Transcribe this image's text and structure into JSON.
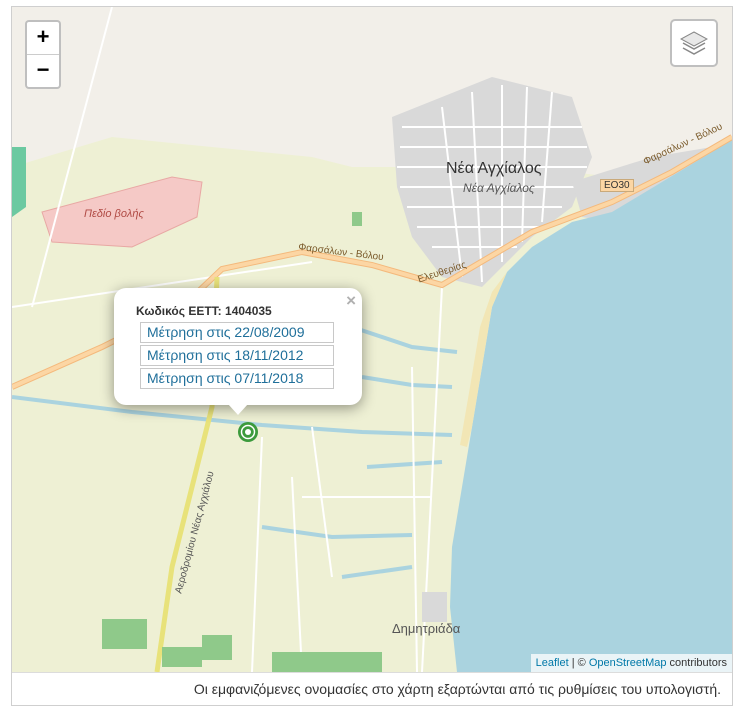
{
  "map": {
    "zoom_in": "+",
    "zoom_out": "−",
    "labels": {
      "town_main": "Νέα Αγχίαλος",
      "town_main_sub": "Νέα Αγχίαλος",
      "shooting_range": "Πεδίο βολής",
      "road_farsala_volos_1": "Φαρσάλων - Βόλου",
      "road_farsala_volos_2": "Φαρσάλων - Βόλου",
      "road_eleftherias": "Ελευθερίας",
      "road_airport": "Αεροδρομίου Νέας Αγχιάλου",
      "route_eo30": "ΕΟ30",
      "dimitriada": "Δημητριάδα"
    },
    "attribution": {
      "leaflet": "Leaflet",
      "separator": " | © ",
      "osm": "OpenStreetMap",
      "suffix": " contributors"
    },
    "popup": {
      "title": "Κωδικός ΕΕΤΤ: 1404035",
      "close": "×",
      "measurements": [
        "Μέτρηση στις 22/08/2009",
        "Μέτρηση στις 18/11/2012",
        "Μέτρηση στις 07/11/2018"
      ]
    },
    "colors": {
      "sea": "#aad3df",
      "land": "#eef0d4",
      "urban": "#d9d9d9",
      "forest": "#add19e",
      "road": "#fcd6a4"
    }
  },
  "footer": {
    "note": "Οι εμφανιζόμενες ονομασίες στο χάρτη εξαρτώνται από τις ρυθμίσεις του υπολογιστή."
  }
}
